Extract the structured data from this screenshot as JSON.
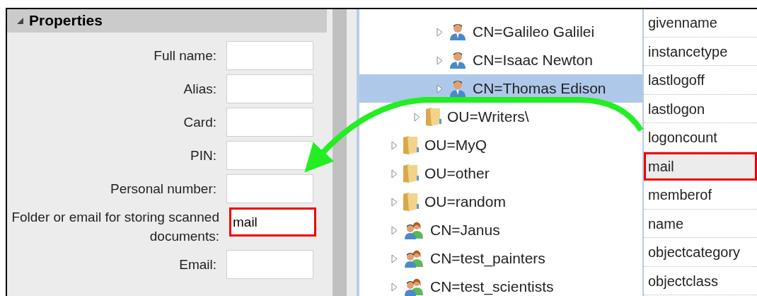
{
  "properties": {
    "title": "Properties",
    "expanded": true,
    "fields": [
      {
        "label": "Full name:",
        "highlighted": false
      },
      {
        "label": "Alias:",
        "highlighted": false
      },
      {
        "label": "Card:",
        "highlighted": false
      },
      {
        "label": "PIN:",
        "highlighted": false
      },
      {
        "label": "Personal number:",
        "highlighted": false
      },
      {
        "label": "Folder or email for storing scanned documents:",
        "value": "mail",
        "highlighted": true
      },
      {
        "label": "Email:",
        "highlighted": false
      }
    ]
  },
  "tree": {
    "items": [
      {
        "children": [
          {
            "children": [
              {
                "label": "CN=Galileo Galilei",
                "kind": "person",
                "selected": false
              },
              {
                "label": "CN=Isaac Newton",
                "kind": "person",
                "selected": false
              },
              {
                "label": "CN=Thomas Edison",
                "kind": "person",
                "selected": true
              }
            ]
          },
          {
            "label": "OU=Writers\\",
            "kind": "folder",
            "selected": false
          }
        ]
      },
      {
        "label": "OU=MyQ",
        "kind": "folder",
        "selected": false
      },
      {
        "label": "OU=other",
        "kind": "folder",
        "selected": false
      },
      {
        "label": "OU=random",
        "kind": "folder",
        "selected": false
      },
      {
        "label": "CN=Janus",
        "kind": "group",
        "selected": false
      },
      {
        "label": "CN=test_painters",
        "kind": "group",
        "selected": false
      },
      {
        "label": "CN=test_scientists",
        "kind": "group",
        "selected": false
      }
    ]
  },
  "attributes": [
    {
      "name": "givenname",
      "selected": false,
      "highlighted": false
    },
    {
      "name": "instancetype",
      "selected": false,
      "highlighted": false
    },
    {
      "name": "lastlogoff",
      "selected": false,
      "highlighted": false
    },
    {
      "name": "lastlogon",
      "selected": false,
      "highlighted": false
    },
    {
      "name": "logoncount",
      "selected": false,
      "highlighted": false
    },
    {
      "name": "mail",
      "selected": true,
      "highlighted": true
    },
    {
      "name": "memberof",
      "selected": false,
      "highlighted": false
    },
    {
      "name": "name",
      "selected": false,
      "highlighted": false
    },
    {
      "name": "objectcategory",
      "selected": false,
      "highlighted": false
    },
    {
      "name": "objectclass",
      "selected": false,
      "highlighted": false
    }
  ]
}
